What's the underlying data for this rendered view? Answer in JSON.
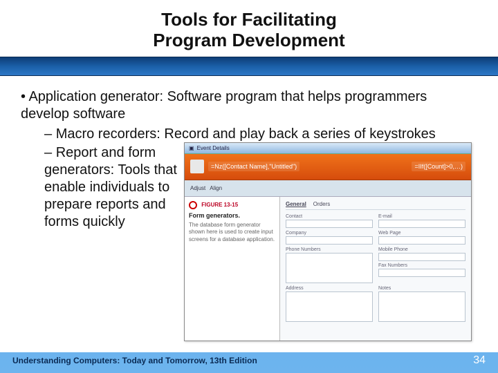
{
  "title_line1": "Tools for Facilitating",
  "title_line2": "Program Development",
  "bullets": {
    "b1": "Application generator: Software program that helps programmers develop software",
    "b2a": "Macro recorders: Record and play back a series of keystrokes",
    "b2b": "Report and form generators: Tools that enable individuals to prepare reports and forms quickly"
  },
  "figure": {
    "titlebar": "Event Details",
    "ribbon_left": "=Nz([Contact Name],\"Untitled\")",
    "ribbon_right": "=IIf([Count]>0,…)",
    "toolbar": {
      "item1": "Adjust",
      "item2": "Align"
    },
    "caption_header": "FIGURE 13-15",
    "caption_title": "Form generators.",
    "caption_body": "The database form generator shown here is used to create input screens for a database application.",
    "tabs": {
      "t1": "General",
      "t2": "Orders"
    },
    "fields": {
      "contact": "Contact",
      "company": "Company",
      "email": "E-mail",
      "webpage": "Web Page",
      "phone": "Phone Numbers",
      "mobile": "Mobile Phone",
      "fax": "Fax Numbers",
      "address": "Address",
      "notes": "Notes"
    }
  },
  "footer": {
    "book": "Understanding Computers: Today and Tomorrow, 13th Edition",
    "page": "34"
  }
}
